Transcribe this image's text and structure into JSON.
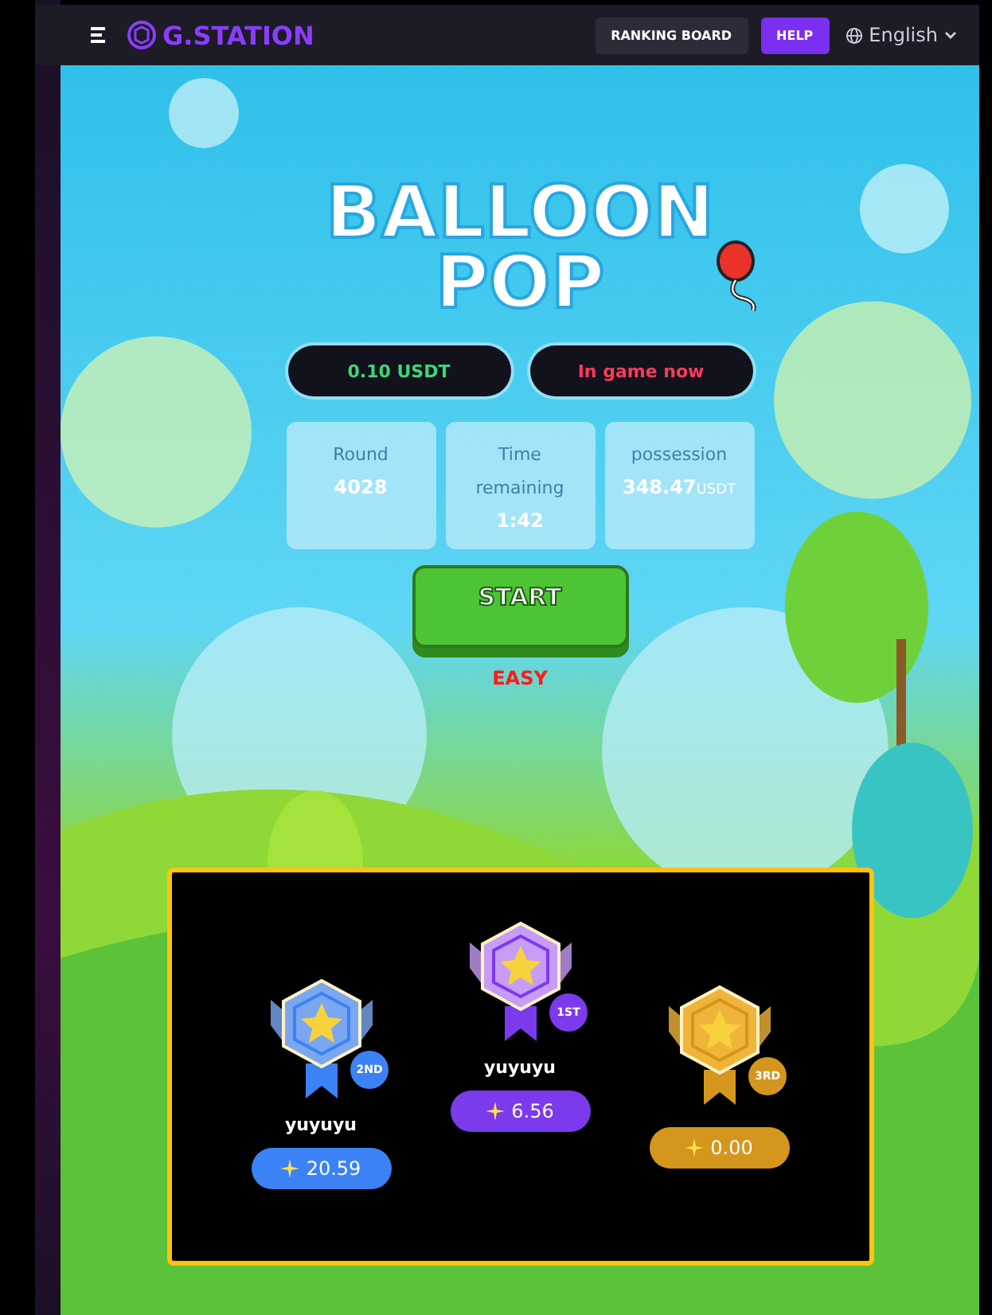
{
  "header": {
    "logo": "G.STATION",
    "buttons": [
      {
        "label": "RANKING BOARD",
        "kind": "dark"
      },
      {
        "label": "HELP",
        "kind": "primary"
      }
    ],
    "language": "English"
  },
  "game": {
    "title_lines": [
      "BALLOON",
      "POP"
    ],
    "price": "0.10 USDT",
    "status": "In game now",
    "stats": [
      {
        "label": "Round",
        "value": "4028"
      },
      {
        "label": "Time remaining",
        "value": "1:42"
      },
      {
        "label": "possession",
        "value": "348.47",
        "unit": "USDT"
      }
    ],
    "start": "START",
    "difficulty": "EASY"
  },
  "podium": [
    {
      "rank": "2ND",
      "name": "yuyuyu",
      "score": "20.59",
      "color": "#3b82f6"
    },
    {
      "rank": "1ST",
      "name": "yuyuyu",
      "score": "6.56",
      "color": "#7c3aed"
    },
    {
      "rank": "3RD",
      "score": "0.00",
      "color": "#d4961c"
    }
  ]
}
